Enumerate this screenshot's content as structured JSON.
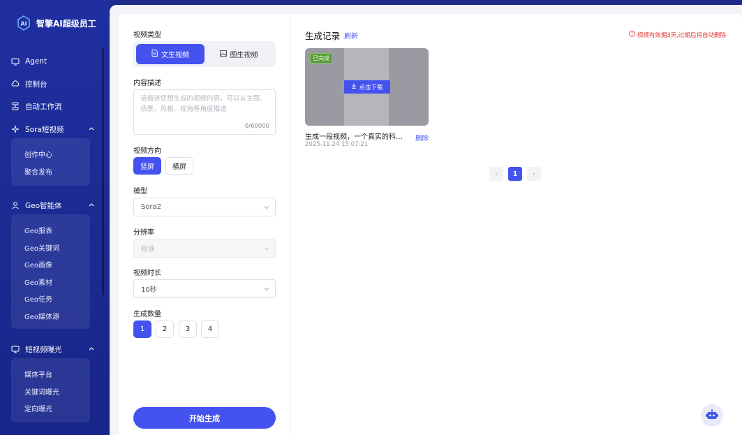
{
  "brand": {
    "name": "智擎AI超级员工"
  },
  "sidebar": {
    "items": [
      {
        "label": "Agent",
        "icon": "monitor-icon"
      },
      {
        "label": "控制台",
        "icon": "cloud-icon"
      },
      {
        "label": "自动工作流",
        "icon": "workflow-icon"
      },
      {
        "label": "Sora短视频",
        "icon": "sparkle-icon",
        "children": [
          "创作中心",
          "聚合发布"
        ]
      },
      {
        "label": "Geo智能体",
        "icon": "user-icon",
        "children": [
          "Geo报表",
          "Geo关键词",
          "Geo画像",
          "Geo素材",
          "Geo任务",
          "Geo媒体源"
        ]
      },
      {
        "label": "短视频曝光",
        "icon": "screen-icon",
        "children": [
          "媒体平台",
          "关键词曝光",
          "定向曝光"
        ]
      }
    ]
  },
  "form": {
    "video_type_label": "视频类型",
    "video_type_options": [
      "文生视频",
      "图生视频"
    ],
    "content_label": "内容描述",
    "content_placeholder": "请描述您想生成的视频内容，可以从主题、场景、风格、视角等角度描述",
    "content_count": "0/60000",
    "orientation_label": "视频方向",
    "orientation_options": [
      "竖屏",
      "横屏"
    ],
    "model_label": "模型",
    "model_value": "Sora2",
    "resolution_label": "分辨率",
    "resolution_value": "标准",
    "duration_label": "视频时长",
    "duration_value": "10秒",
    "quantity_label": "生成数量",
    "quantity_options": [
      "1",
      "2",
      "3",
      "4"
    ],
    "quantity_selected": "1",
    "start_label": "开始生成"
  },
  "records": {
    "title": "生成记录",
    "refresh_label": "刷新",
    "notice": "视频有效期3天,过期后将自动删除",
    "items": [
      {
        "status": "已完成",
        "download_label": "点击下载",
        "title": "生成一段视频，一个真实的科…",
        "date": "2025-11-24 15:07:21",
        "delete_label": "删除"
      }
    ],
    "pagination": {
      "prev": "‹",
      "current": "1",
      "next": "›"
    }
  },
  "colors": {
    "primary": "#4452f0",
    "sidebar": "#1f2fa0",
    "danger": "#e53935",
    "success_badge": "#5a9a3c"
  }
}
